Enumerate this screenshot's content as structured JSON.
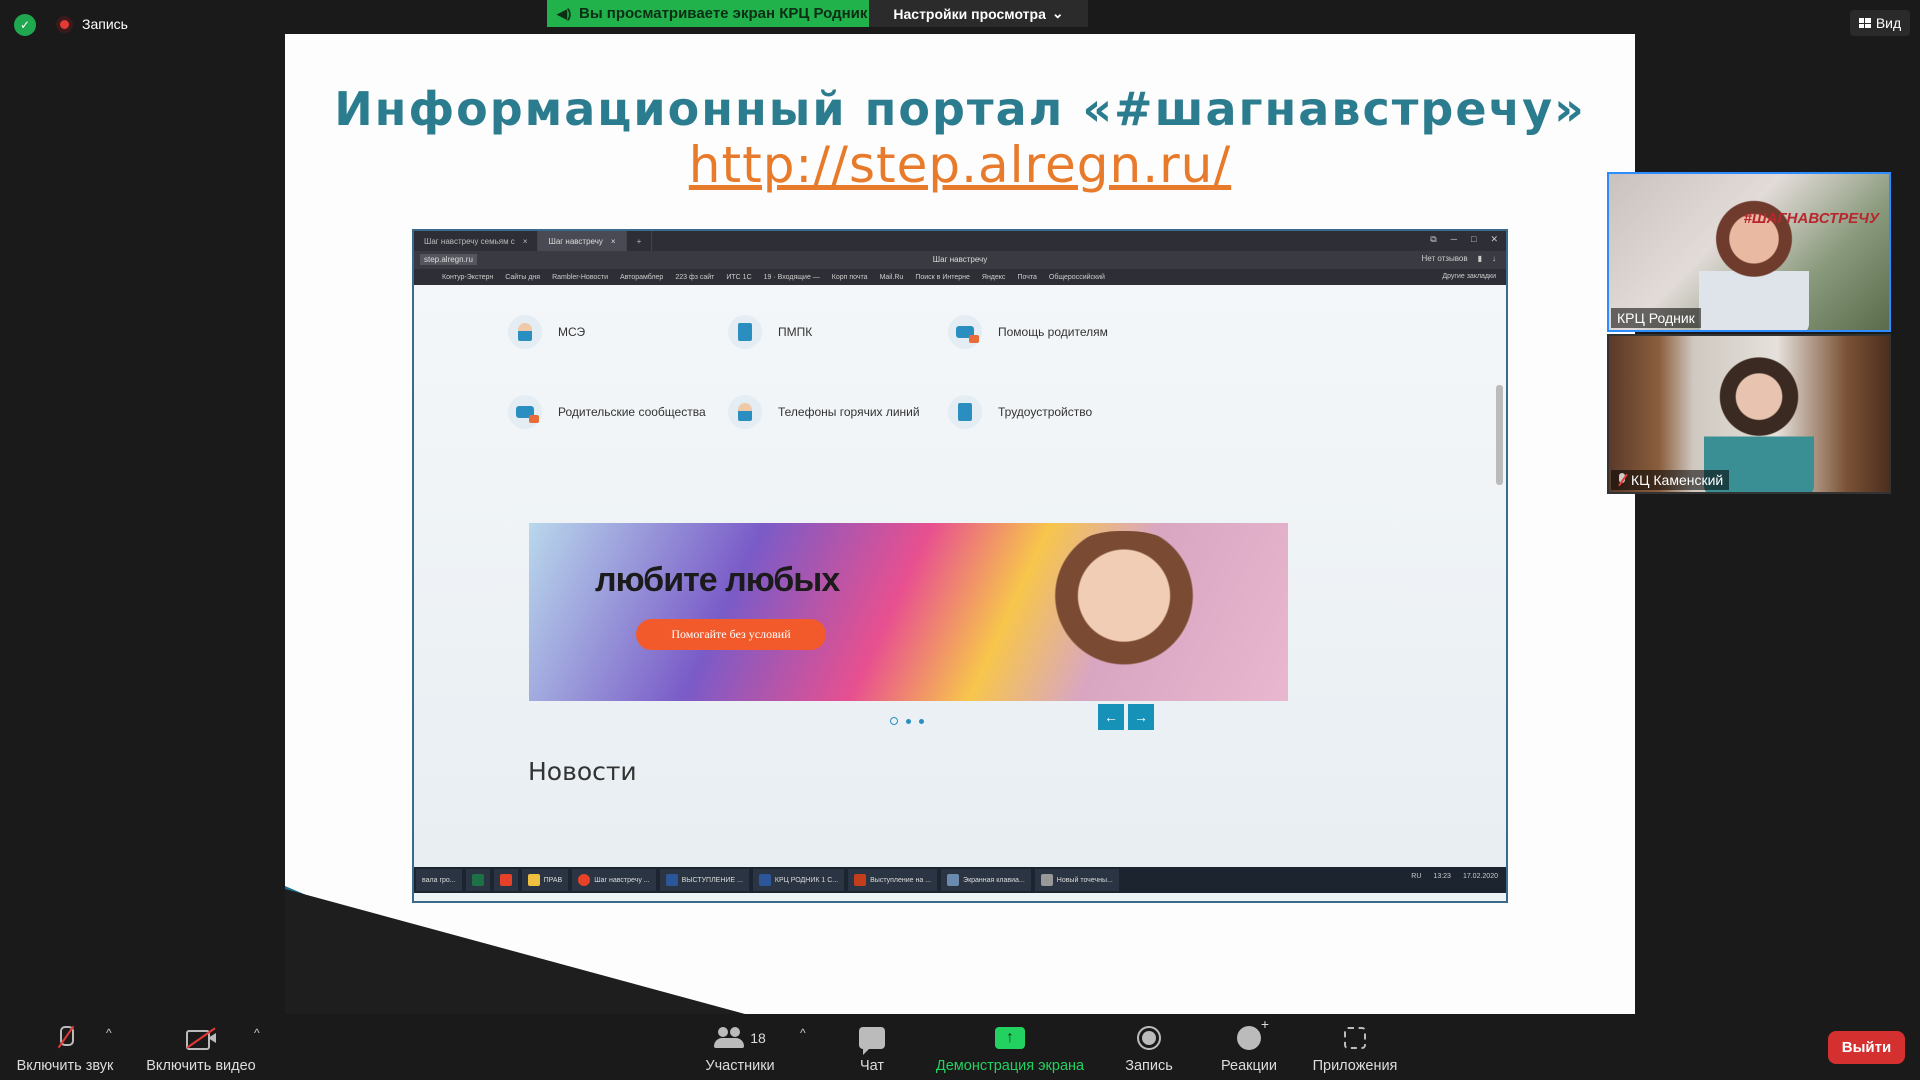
{
  "top": {
    "security_icon": "shield-check-icon",
    "recording_label": "Запись",
    "share_banner": "Вы просматриваете экран КРЦ Родник",
    "view_options": "Настройки просмотра",
    "view_button": "Вид"
  },
  "slide": {
    "title": "Информационный портал «#шагнавстречу»",
    "url": "http://step.alregn.ru/"
  },
  "browser": {
    "tabs": [
      "Шаг навстречу семьям с",
      "Шаг навстречу"
    ],
    "address": "step.alregn.ru",
    "page_title": "Шаг навстречу",
    "no_reviews": "Нет отзывов",
    "bookmarks": [
      "Контур-Экстерн",
      "Сайты дня",
      "Rambler-Новости",
      "Авторамблер",
      "223 фз сайт",
      "ИТС 1С",
      "19 · Входящие —",
      "Корп почта",
      "Mail.Ru",
      "Поиск в Интерне",
      "Яндекс",
      "Почта",
      "Общероссийский"
    ],
    "other_bookmarks": "Другие закладки",
    "tiles": [
      "МСЭ",
      "ПМПК",
      "Помощь родителям",
      "Родительские сообщества",
      "Телефоны горячих линий",
      "Трудоустройство"
    ],
    "promo_text": "любите любых",
    "promo_button": "Помогайте без условий",
    "news_heading": "Новости",
    "taskbar_items": [
      "вала гро...",
      "ПРАВ",
      "Шаг навстречу ...",
      "ВЫСТУПЛЕНИЕ ...",
      "КРЦ РОДНИК 1 С...",
      "Выступление на ...",
      "Экранная клавиа...",
      "Новый точечны..."
    ],
    "tray_lang": "RU",
    "tray_time": "13:23",
    "tray_date": "17.02.2020"
  },
  "participants": [
    {
      "name": "КРЦ Родник",
      "sign": "#ШАГНАВСТРЕЧУ"
    },
    {
      "name": "КЦ Каменский",
      "muted": true
    }
  ],
  "toolbar": {
    "unmute": "Включить звук",
    "start_video": "Включить видео",
    "participants_count": "18",
    "participants": "Участники",
    "chat": "Чат",
    "share_screen": "Демонстрация экрана",
    "record": "Запись",
    "reactions": "Реакции",
    "apps": "Приложения",
    "leave": "Выйти"
  },
  "colors": {
    "share_green": "#23d160",
    "leave_red": "#d3302f",
    "active_speaker": "#2d8cff"
  }
}
